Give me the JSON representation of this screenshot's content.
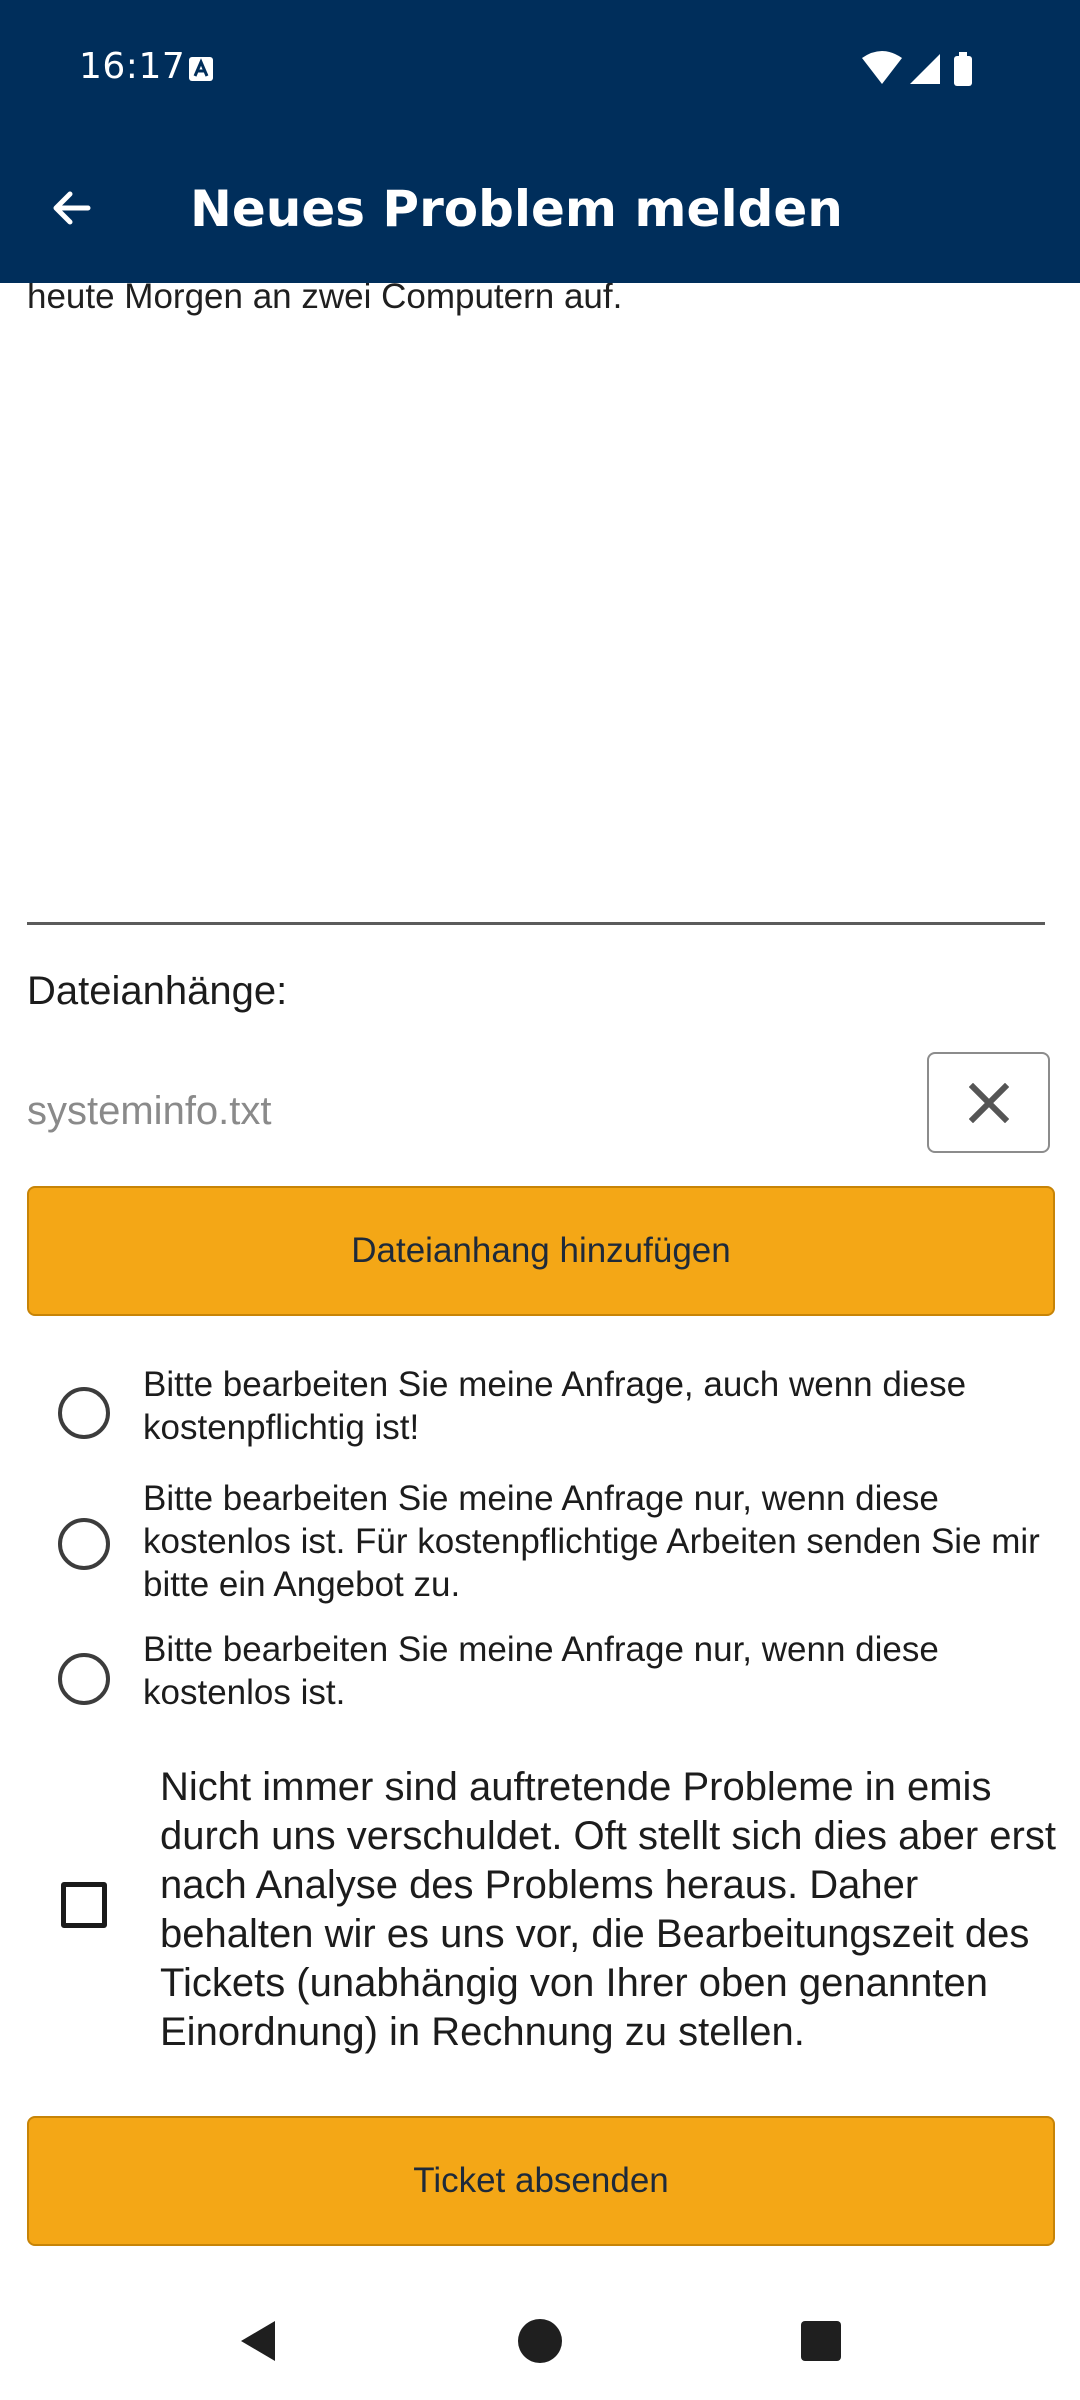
{
  "status_bar": {
    "time": "16:17",
    "icons": [
      "text-a-notification-icon",
      "wifi-icon",
      "signal-icon",
      "battery-icon"
    ]
  },
  "app_bar": {
    "title": "Neues Problem melden",
    "back_icon": "arrow-back-icon",
    "background": "#002e5b"
  },
  "description": {
    "visible_text": "heute Morgen an zwei Computern auf."
  },
  "attachments": {
    "label": "Dateianhänge:",
    "files": [
      {
        "name": "systeminfo.txt",
        "remove_icon": "close-icon"
      }
    ],
    "add_button_label": "Dateianhang hinzufügen"
  },
  "cost_options": [
    {
      "label": "Bitte bearbeiten Sie meine Anfrage, auch wenn diese kostenpflichtig ist!",
      "selected": false
    },
    {
      "label": "Bitte bearbeiten Sie meine Anfrage nur, wenn diese kostenlos ist. Für kostenpflichtige Arbeiten senden Sie mir bitte ein Angebot zu.",
      "selected": false
    },
    {
      "label": "Bitte bearbeiten Sie meine Anfrage nur, wenn diese kostenlos ist.",
      "selected": false
    }
  ],
  "disclaimer": {
    "checked": false,
    "text": "Nicht immer sind auftretende Probleme in emis durch uns verschuldet. Oft stellt sich dies aber erst nach Analyse des Problems heraus. Daher behalten wir es uns vor, die Bearbeitungszeit des Tickets (unabhängig von Ihrer oben genannten Einordnung) in Rechnung zu stellen."
  },
  "submit_button_label": "Ticket absenden",
  "colors": {
    "accent": "#f4a716",
    "primary": "#002e5b"
  },
  "nav_bar": {
    "icons": [
      "nav-back-icon",
      "nav-home-icon",
      "nav-recents-icon"
    ]
  }
}
